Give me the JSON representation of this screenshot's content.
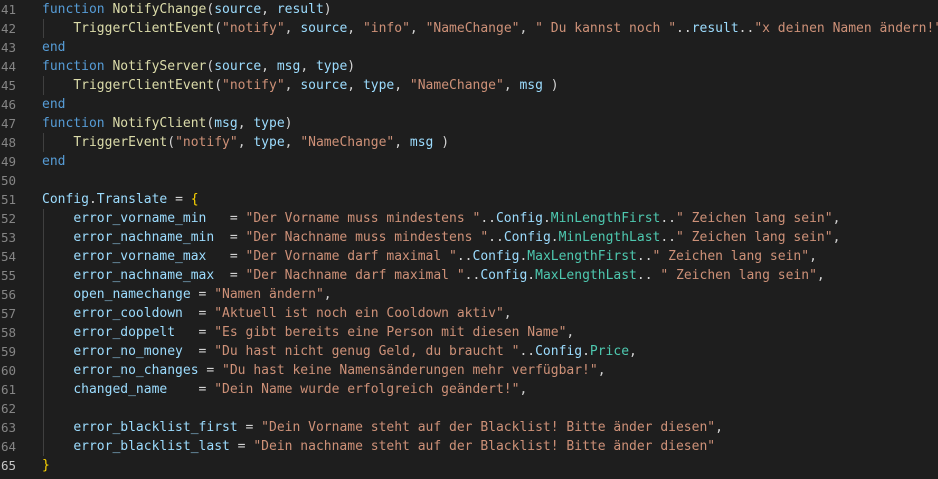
{
  "editor": {
    "lines": [
      {
        "num": "41",
        "indent": 0,
        "tokens": [
          [
            "kw2",
            "function"
          ],
          [
            "text",
            " "
          ],
          [
            "fn",
            "NotifyChange"
          ],
          [
            "punct",
            "("
          ],
          [
            "param",
            "source"
          ],
          [
            "punct",
            ", "
          ],
          [
            "param",
            "result"
          ],
          [
            "punct",
            ")"
          ]
        ]
      },
      {
        "num": "42",
        "indent": 1,
        "tokens": [
          [
            "fn",
            "TriggerClientEvent"
          ],
          [
            "punct",
            "("
          ],
          [
            "string",
            "\"notify\""
          ],
          [
            "punct",
            ", "
          ],
          [
            "var",
            "source"
          ],
          [
            "punct",
            ", "
          ],
          [
            "string",
            "\"info\""
          ],
          [
            "punct",
            ", "
          ],
          [
            "string",
            "\"NameChange\""
          ],
          [
            "punct",
            ", "
          ],
          [
            "string",
            "\" Du kannst noch \""
          ],
          [
            "punct",
            ".."
          ],
          [
            "var",
            "result"
          ],
          [
            "punct",
            ".."
          ],
          [
            "string",
            "\"x deinen Namen ändern!\""
          ]
        ]
      },
      {
        "num": "43",
        "indent": 0,
        "tokens": [
          [
            "kw2",
            "end"
          ]
        ]
      },
      {
        "num": "44",
        "indent": 0,
        "tokens": [
          [
            "kw2",
            "function"
          ],
          [
            "text",
            " "
          ],
          [
            "fn",
            "NotifyServer"
          ],
          [
            "punct",
            "("
          ],
          [
            "param",
            "source"
          ],
          [
            "punct",
            ", "
          ],
          [
            "param",
            "msg"
          ],
          [
            "punct",
            ", "
          ],
          [
            "param",
            "type"
          ],
          [
            "punct",
            ")"
          ]
        ]
      },
      {
        "num": "45",
        "indent": 1,
        "tokens": [
          [
            "fn",
            "TriggerClientEvent"
          ],
          [
            "punct",
            "("
          ],
          [
            "string",
            "\"notify\""
          ],
          [
            "punct",
            ", "
          ],
          [
            "var",
            "source"
          ],
          [
            "punct",
            ", "
          ],
          [
            "var",
            "type"
          ],
          [
            "punct",
            ", "
          ],
          [
            "string",
            "\"NameChange\""
          ],
          [
            "punct",
            ", "
          ],
          [
            "var",
            "msg"
          ],
          [
            "punct",
            " )"
          ]
        ]
      },
      {
        "num": "46",
        "indent": 0,
        "tokens": [
          [
            "kw2",
            "end"
          ]
        ]
      },
      {
        "num": "47",
        "indent": 0,
        "tokens": [
          [
            "kw2",
            "function"
          ],
          [
            "text",
            " "
          ],
          [
            "fn",
            "NotifyClient"
          ],
          [
            "punct",
            "("
          ],
          [
            "param",
            "msg"
          ],
          [
            "punct",
            ", "
          ],
          [
            "param",
            "type"
          ],
          [
            "punct",
            ")"
          ]
        ]
      },
      {
        "num": "48",
        "indent": 1,
        "tokens": [
          [
            "fn",
            "TriggerEvent"
          ],
          [
            "punct",
            "("
          ],
          [
            "string",
            "\"notify\""
          ],
          [
            "punct",
            ", "
          ],
          [
            "var",
            "type"
          ],
          [
            "punct",
            ", "
          ],
          [
            "string",
            "\"NameChange\""
          ],
          [
            "punct",
            ", "
          ],
          [
            "var",
            "msg"
          ],
          [
            "punct",
            " )"
          ]
        ]
      },
      {
        "num": "49",
        "indent": 0,
        "tokens": [
          [
            "kw2",
            "end"
          ]
        ]
      },
      {
        "num": "50",
        "indent": 0,
        "tokens": []
      },
      {
        "num": "51",
        "indent": 0,
        "tokens": [
          [
            "var",
            "Config"
          ],
          [
            "punct",
            "."
          ],
          [
            "var",
            "Translate"
          ],
          [
            "punct",
            " = "
          ],
          [
            "brace",
            "{"
          ]
        ]
      },
      {
        "num": "52",
        "indent": 1,
        "tokens": [
          [
            "prop",
            "error_vorname_min"
          ],
          [
            "punct",
            "   = "
          ],
          [
            "string",
            "\"Der Vorname muss mindestens \""
          ],
          [
            "punct",
            ".."
          ],
          [
            "var",
            "Config"
          ],
          [
            "punct",
            "."
          ],
          [
            "class",
            "MinLengthFirst"
          ],
          [
            "punct",
            ".."
          ],
          [
            "string",
            "\" Zeichen lang sein\""
          ],
          [
            "punct",
            ","
          ]
        ]
      },
      {
        "num": "53",
        "indent": 1,
        "tokens": [
          [
            "prop",
            "error_nachname_min"
          ],
          [
            "punct",
            "  = "
          ],
          [
            "string",
            "\"Der Nachname muss mindestens \""
          ],
          [
            "punct",
            ".."
          ],
          [
            "var",
            "Config"
          ],
          [
            "punct",
            "."
          ],
          [
            "class",
            "MinLengthLast"
          ],
          [
            "punct",
            ".."
          ],
          [
            "string",
            "\" Zeichen lang sein\""
          ],
          [
            "punct",
            ","
          ]
        ]
      },
      {
        "num": "54",
        "indent": 1,
        "tokens": [
          [
            "prop",
            "error_vorname_max"
          ],
          [
            "punct",
            "   = "
          ],
          [
            "string",
            "\"Der Vorname darf maximal \""
          ],
          [
            "punct",
            ".."
          ],
          [
            "var",
            "Config"
          ],
          [
            "punct",
            "."
          ],
          [
            "class",
            "MaxLengthFirst"
          ],
          [
            "punct",
            ".."
          ],
          [
            "string",
            "\" Zeichen lang sein\""
          ],
          [
            "punct",
            ","
          ]
        ]
      },
      {
        "num": "55",
        "indent": 1,
        "tokens": [
          [
            "prop",
            "error_nachname_max"
          ],
          [
            "punct",
            "  = "
          ],
          [
            "string",
            "\"Der Nachname darf maximal \""
          ],
          [
            "punct",
            ".."
          ],
          [
            "var",
            "Config"
          ],
          [
            "punct",
            "."
          ],
          [
            "class",
            "MaxLengthLast"
          ],
          [
            "punct",
            ".. "
          ],
          [
            "string",
            "\" Zeichen lang sein\""
          ],
          [
            "punct",
            ","
          ]
        ]
      },
      {
        "num": "56",
        "indent": 1,
        "tokens": [
          [
            "prop",
            "open_namechange"
          ],
          [
            "punct",
            " = "
          ],
          [
            "string",
            "\"Namen ändern\""
          ],
          [
            "punct",
            ","
          ]
        ]
      },
      {
        "num": "57",
        "indent": 1,
        "tokens": [
          [
            "prop",
            "error_cooldown"
          ],
          [
            "punct",
            "  = "
          ],
          [
            "string",
            "\"Aktuell ist noch ein Cooldown aktiv\""
          ],
          [
            "punct",
            ","
          ]
        ]
      },
      {
        "num": "58",
        "indent": 1,
        "tokens": [
          [
            "prop",
            "error_doppelt"
          ],
          [
            "punct",
            "   = "
          ],
          [
            "string",
            "\"Es gibt bereits eine Person mit diesen Name\""
          ],
          [
            "punct",
            ","
          ]
        ]
      },
      {
        "num": "59",
        "indent": 1,
        "tokens": [
          [
            "prop",
            "error_no_money"
          ],
          [
            "punct",
            "  = "
          ],
          [
            "string",
            "\"Du hast nicht genug Geld, du braucht \""
          ],
          [
            "punct",
            ".."
          ],
          [
            "var",
            "Config"
          ],
          [
            "punct",
            "."
          ],
          [
            "class",
            "Price"
          ],
          [
            "punct",
            ","
          ]
        ]
      },
      {
        "num": "60",
        "indent": 1,
        "tokens": [
          [
            "prop",
            "error_no_changes"
          ],
          [
            "punct",
            " = "
          ],
          [
            "string",
            "\"Du hast keine Namensänderungen mehr verfügbar!\""
          ],
          [
            "punct",
            ","
          ]
        ]
      },
      {
        "num": "61",
        "indent": 1,
        "tokens": [
          [
            "prop",
            "changed_name"
          ],
          [
            "punct",
            "    = "
          ],
          [
            "string",
            "\"Dein Name wurde erfolgreich geändert!\""
          ],
          [
            "punct",
            ","
          ]
        ]
      },
      {
        "num": "62",
        "indent": 1,
        "tokens": []
      },
      {
        "num": "63",
        "indent": 1,
        "tokens": [
          [
            "prop",
            "error_blacklist_first"
          ],
          [
            "punct",
            " = "
          ],
          [
            "string",
            "\"Dein Vorname steht auf der Blacklist! Bitte änder diesen\""
          ],
          [
            "punct",
            ","
          ]
        ]
      },
      {
        "num": "64",
        "indent": 1,
        "tokens": [
          [
            "prop",
            "error_blacklist_last"
          ],
          [
            "punct",
            " = "
          ],
          [
            "string",
            "\"Dein nachname steht auf der Blacklist! Bitte änder diesen\""
          ]
        ]
      },
      {
        "num": "65",
        "indent": 0,
        "current": true,
        "tokens": [
          [
            "brace",
            "}"
          ]
        ]
      }
    ]
  }
}
